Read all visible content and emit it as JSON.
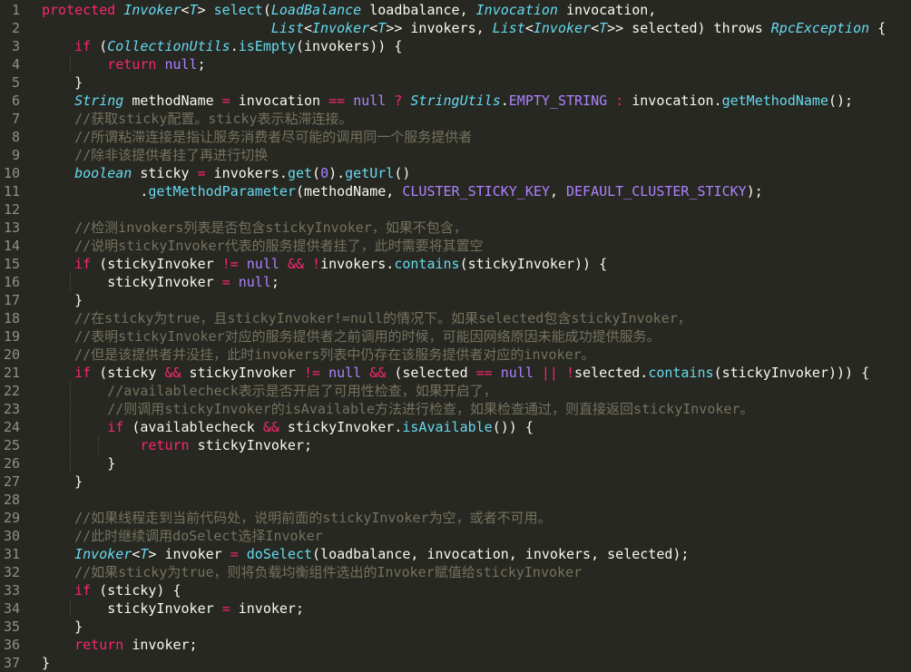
{
  "colors": {
    "background": "#272822",
    "line_number": "#8f908a",
    "plain": "#f8f8f2",
    "keyword": "#f92672",
    "type": "#66d9ef",
    "function": "#66d9ef",
    "constant": "#ae81ff",
    "comment": "#75715e"
  },
  "lines": [
    {
      "n": "1",
      "tokens": [
        [
          "kw",
          "protected"
        ],
        [
          "p",
          " "
        ],
        [
          "type",
          "Invoker"
        ],
        [
          "p",
          "<"
        ],
        [
          "type",
          "T"
        ],
        [
          "p",
          "> "
        ],
        [
          "fn",
          "select"
        ],
        [
          "p",
          "("
        ],
        [
          "type",
          "LoadBalance"
        ],
        [
          "p",
          " loadbalance, "
        ],
        [
          "type",
          "Invocation"
        ],
        [
          "p",
          " invocation,"
        ]
      ]
    },
    {
      "n": "2",
      "tokens": [
        [
          "p",
          "                            "
        ],
        [
          "type",
          "List"
        ],
        [
          "p",
          "<"
        ],
        [
          "type",
          "Invoker"
        ],
        [
          "p",
          "<"
        ],
        [
          "type",
          "T"
        ],
        [
          "p",
          ">> invokers, "
        ],
        [
          "type",
          "List"
        ],
        [
          "p",
          "<"
        ],
        [
          "type",
          "Invoker"
        ],
        [
          "p",
          "<"
        ],
        [
          "type",
          "T"
        ],
        [
          "p",
          ">> selected) throws "
        ],
        [
          "type",
          "RpcException"
        ],
        [
          "p",
          " {"
        ]
      ]
    },
    {
      "n": "3",
      "tokens": [
        [
          "p",
          "    "
        ],
        [
          "kw",
          "if"
        ],
        [
          "p",
          " ("
        ],
        [
          "type",
          "CollectionUtils"
        ],
        [
          "p",
          "."
        ],
        [
          "fn",
          "isEmpty"
        ],
        [
          "p",
          "(invokers)) {"
        ]
      ]
    },
    {
      "n": "4",
      "tokens": [
        [
          "p",
          "        "
        ],
        [
          "kw",
          "return"
        ],
        [
          "p",
          " "
        ],
        [
          "const",
          "null"
        ],
        [
          "p",
          ";"
        ]
      ]
    },
    {
      "n": "5",
      "tokens": [
        [
          "p",
          "    }"
        ]
      ]
    },
    {
      "n": "6",
      "tokens": [
        [
          "p",
          "    "
        ],
        [
          "type",
          "String"
        ],
        [
          "p",
          " methodName "
        ],
        [
          "op",
          "="
        ],
        [
          "p",
          " invocation "
        ],
        [
          "op",
          "=="
        ],
        [
          "p",
          " "
        ],
        [
          "const",
          "null"
        ],
        [
          "p",
          " "
        ],
        [
          "op",
          "?"
        ],
        [
          "p",
          " "
        ],
        [
          "type",
          "StringUtils"
        ],
        [
          "p",
          "."
        ],
        [
          "const",
          "EMPTY_STRING"
        ],
        [
          "p",
          " "
        ],
        [
          "op",
          ":"
        ],
        [
          "p",
          " invocation."
        ],
        [
          "fn",
          "getMethodName"
        ],
        [
          "p",
          "();"
        ]
      ]
    },
    {
      "n": "7",
      "tokens": [
        [
          "p",
          "    "
        ],
        [
          "cm",
          "//获取sticky配置。sticky表示粘滞连接。"
        ]
      ]
    },
    {
      "n": "8",
      "tokens": [
        [
          "p",
          "    "
        ],
        [
          "cm",
          "//所谓粘滞连接是指让服务消费者尽可能的调用同一个服务提供者"
        ]
      ]
    },
    {
      "n": "9",
      "tokens": [
        [
          "p",
          "    "
        ],
        [
          "cm",
          "//除非该提供者挂了再进行切换"
        ]
      ]
    },
    {
      "n": "10",
      "tokens": [
        [
          "p",
          "    "
        ],
        [
          "type",
          "boolean"
        ],
        [
          "p",
          " sticky "
        ],
        [
          "op",
          "="
        ],
        [
          "p",
          " invokers."
        ],
        [
          "fn",
          "get"
        ],
        [
          "p",
          "("
        ],
        [
          "const",
          "0"
        ],
        [
          "p",
          ")."
        ],
        [
          "fn",
          "getUrl"
        ],
        [
          "p",
          "()"
        ]
      ]
    },
    {
      "n": "11",
      "tokens": [
        [
          "p",
          "            ."
        ],
        [
          "fn",
          "getMethodParameter"
        ],
        [
          "p",
          "(methodName, "
        ],
        [
          "const",
          "CLUSTER_STICKY_KEY"
        ],
        [
          "p",
          ", "
        ],
        [
          "const",
          "DEFAULT_CLUSTER_STICKY"
        ],
        [
          "p",
          ");"
        ]
      ]
    },
    {
      "n": "12",
      "tokens": []
    },
    {
      "n": "13",
      "tokens": [
        [
          "p",
          "    "
        ],
        [
          "cm",
          "//检测invokers列表是否包含stickyInvoker，如果不包含，"
        ]
      ]
    },
    {
      "n": "14",
      "tokens": [
        [
          "p",
          "    "
        ],
        [
          "cm",
          "//说明stickyInvoker代表的服务提供者挂了，此时需要将其置空"
        ]
      ]
    },
    {
      "n": "15",
      "tokens": [
        [
          "p",
          "    "
        ],
        [
          "kw",
          "if"
        ],
        [
          "p",
          " (stickyInvoker "
        ],
        [
          "op",
          "!="
        ],
        [
          "p",
          " "
        ],
        [
          "const",
          "null"
        ],
        [
          "p",
          " "
        ],
        [
          "op",
          "&&"
        ],
        [
          "p",
          " "
        ],
        [
          "op",
          "!"
        ],
        [
          "p",
          "invokers."
        ],
        [
          "fn",
          "contains"
        ],
        [
          "p",
          "(stickyInvoker)) {"
        ]
      ]
    },
    {
      "n": "16",
      "tokens": [
        [
          "p",
          "        stickyInvoker "
        ],
        [
          "op",
          "="
        ],
        [
          "p",
          " "
        ],
        [
          "const",
          "null"
        ],
        [
          "p",
          ";"
        ]
      ]
    },
    {
      "n": "17",
      "tokens": [
        [
          "p",
          "    }"
        ]
      ]
    },
    {
      "n": "18",
      "tokens": [
        [
          "p",
          "    "
        ],
        [
          "cm",
          "//在sticky为true，且stickyInvoker!=null的情况下。如果selected包含stickyInvoker，"
        ]
      ]
    },
    {
      "n": "19",
      "tokens": [
        [
          "p",
          "    "
        ],
        [
          "cm",
          "//表明stickyInvoker对应的服务提供者之前调用的时候，可能因网络原因未能成功提供服务。"
        ]
      ]
    },
    {
      "n": "20",
      "tokens": [
        [
          "p",
          "    "
        ],
        [
          "cm",
          "//但是该提供者并没挂，此时invokers列表中仍存在该服务提供者对应的invoker。"
        ]
      ]
    },
    {
      "n": "21",
      "tokens": [
        [
          "p",
          "    "
        ],
        [
          "kw",
          "if"
        ],
        [
          "p",
          " (sticky "
        ],
        [
          "op",
          "&&"
        ],
        [
          "p",
          " stickyInvoker "
        ],
        [
          "op",
          "!="
        ],
        [
          "p",
          " "
        ],
        [
          "const",
          "null"
        ],
        [
          "p",
          " "
        ],
        [
          "op",
          "&&"
        ],
        [
          "p",
          " (selected "
        ],
        [
          "op",
          "=="
        ],
        [
          "p",
          " "
        ],
        [
          "const",
          "null"
        ],
        [
          "p",
          " "
        ],
        [
          "op",
          "||"
        ],
        [
          "p",
          " "
        ],
        [
          "op",
          "!"
        ],
        [
          "p",
          "selected."
        ],
        [
          "fn",
          "contains"
        ],
        [
          "p",
          "(stickyInvoker))) {"
        ]
      ]
    },
    {
      "n": "22",
      "tokens": [
        [
          "p",
          "        "
        ],
        [
          "cm",
          "//availablecheck表示是否开启了可用性检查，如果开启了，"
        ]
      ]
    },
    {
      "n": "23",
      "tokens": [
        [
          "p",
          "        "
        ],
        [
          "cm",
          "//则调用stickyInvoker的isAvailable方法进行检查，如果检查通过，则直接返回stickyInvoker。"
        ]
      ]
    },
    {
      "n": "24",
      "tokens": [
        [
          "p",
          "        "
        ],
        [
          "kw",
          "if"
        ],
        [
          "p",
          " (availablecheck "
        ],
        [
          "op",
          "&&"
        ],
        [
          "p",
          " stickyInvoker."
        ],
        [
          "fn",
          "isAvailable"
        ],
        [
          "p",
          "()) {"
        ]
      ]
    },
    {
      "n": "25",
      "tokens": [
        [
          "p",
          "            "
        ],
        [
          "kw",
          "return"
        ],
        [
          "p",
          " stickyInvoker;"
        ]
      ]
    },
    {
      "n": "26",
      "tokens": [
        [
          "p",
          "        }"
        ]
      ]
    },
    {
      "n": "27",
      "tokens": [
        [
          "p",
          "    }"
        ]
      ]
    },
    {
      "n": "28",
      "tokens": []
    },
    {
      "n": "29",
      "tokens": [
        [
          "p",
          "    "
        ],
        [
          "cm",
          "//如果线程走到当前代码处，说明前面的stickyInvoker为空，或者不可用。"
        ]
      ]
    },
    {
      "n": "30",
      "tokens": [
        [
          "p",
          "    "
        ],
        [
          "cm",
          "//此时继续调用doSelect选择Invoker"
        ]
      ]
    },
    {
      "n": "31",
      "tokens": [
        [
          "p",
          "    "
        ],
        [
          "type",
          "Invoker"
        ],
        [
          "p",
          "<"
        ],
        [
          "type",
          "T"
        ],
        [
          "p",
          "> invoker "
        ],
        [
          "op",
          "="
        ],
        [
          "p",
          " "
        ],
        [
          "fn",
          "doSelect"
        ],
        [
          "p",
          "(loadbalance, invocation, invokers, selected);"
        ]
      ]
    },
    {
      "n": "32",
      "tokens": [
        [
          "p",
          "    "
        ],
        [
          "cm",
          "//如果sticky为true，则将负载均衡组件选出的Invoker赋值给stickyInvoker"
        ]
      ]
    },
    {
      "n": "33",
      "tokens": [
        [
          "p",
          "    "
        ],
        [
          "kw",
          "if"
        ],
        [
          "p",
          " (sticky) {"
        ]
      ]
    },
    {
      "n": "34",
      "tokens": [
        [
          "p",
          "        stickyInvoker "
        ],
        [
          "op",
          "="
        ],
        [
          "p",
          " invoker;"
        ]
      ]
    },
    {
      "n": "35",
      "tokens": [
        [
          "p",
          "    }"
        ]
      ]
    },
    {
      "n": "36",
      "tokens": [
        [
          "p",
          "    "
        ],
        [
          "kw",
          "return"
        ],
        [
          "p",
          " invoker;"
        ]
      ]
    },
    {
      "n": "37",
      "tokens": [
        [
          "p",
          "}"
        ]
      ]
    }
  ]
}
